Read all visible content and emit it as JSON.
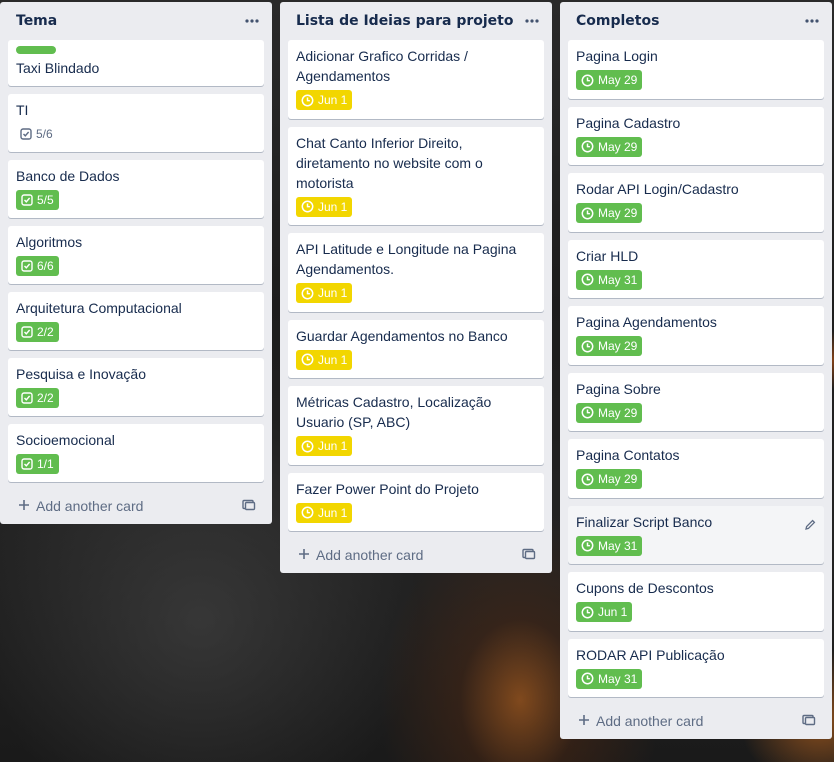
{
  "lists": [
    {
      "title": "Tema",
      "cards": [
        {
          "title": "Taxi Blindado",
          "label": "green"
        },
        {
          "title": "TI",
          "checklist": "5/6",
          "checklist_complete": false
        },
        {
          "title": "Banco de Dados",
          "checklist": "5/5",
          "checklist_complete": true
        },
        {
          "title": "Algoritmos",
          "checklist": "6/6",
          "checklist_complete": true
        },
        {
          "title": "Arquitetura Computacional",
          "checklist": "2/2",
          "checklist_complete": true
        },
        {
          "title": "Pesquisa e Inovação",
          "checklist": "2/2",
          "checklist_complete": true
        },
        {
          "title": "Socioemocional",
          "checklist": "1/1",
          "checklist_complete": true
        }
      ],
      "add_card_label": "Add another card"
    },
    {
      "title": "Lista de Ideias para projeto",
      "cards": [
        {
          "title": "Adicionar Grafico Corridas / Agendamentos",
          "due": "Jun 1",
          "due_color": "yellow"
        },
        {
          "title": "Chat Canto Inferior Direito, diretamento no website com o motorista",
          "due": "Jun 1",
          "due_color": "yellow"
        },
        {
          "title": "API Latitude e Longitude na Pagina Agendamentos.",
          "due": "Jun 1",
          "due_color": "yellow"
        },
        {
          "title": "Guardar Agendamentos no Banco",
          "due": "Jun 1",
          "due_color": "yellow"
        },
        {
          "title": "Métricas Cadastro, Localização Usuario (SP, ABC)",
          "due": "Jun 1",
          "due_color": "yellow"
        },
        {
          "title": "Fazer Power Point do Projeto",
          "due": "Jun 1",
          "due_color": "yellow"
        }
      ],
      "add_card_label": "Add another card"
    },
    {
      "title": "Completos",
      "cards": [
        {
          "title": "Pagina Login",
          "due": "May 29",
          "due_color": "green"
        },
        {
          "title": "Pagina Cadastro",
          "due": "May 29",
          "due_color": "green"
        },
        {
          "title": "Rodar API Login/Cadastro",
          "due": "May 29",
          "due_color": "green"
        },
        {
          "title": "Criar HLD",
          "due": "May 31",
          "due_color": "green"
        },
        {
          "title": "Pagina Agendamentos",
          "due": "May 29",
          "due_color": "green"
        },
        {
          "title": "Pagina Sobre",
          "due": "May 29",
          "due_color": "green"
        },
        {
          "title": "Pagina Contatos",
          "due": "May 29",
          "due_color": "green"
        },
        {
          "title": "Finalizar Script Banco",
          "due": "May 31",
          "due_color": "green",
          "hovered": true
        },
        {
          "title": "Cupons de Descontos",
          "due": "Jun 1",
          "due_color": "green"
        },
        {
          "title": "RODAR API Publicação",
          "due": "May 31",
          "due_color": "green"
        }
      ],
      "add_card_label": "Add another card"
    }
  ],
  "colors": {
    "green": "#61bd4f",
    "yellow": "#f2d600",
    "list_bg": "#ebecf0"
  },
  "icons": {
    "list_menu": "ellipsis-icon",
    "checklist": "checkbox-icon",
    "due": "clock-icon",
    "add": "plus-icon",
    "template": "card-template-icon",
    "edit": "pencil-icon"
  }
}
